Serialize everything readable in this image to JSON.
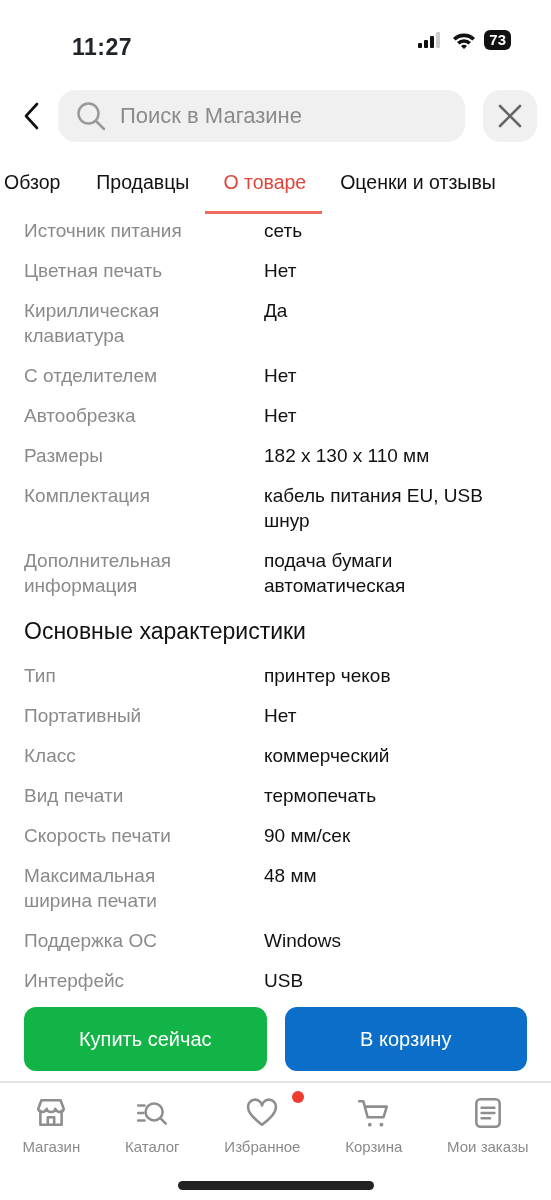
{
  "status_bar": {
    "time": "11:27",
    "battery": "73"
  },
  "search": {
    "placeholder": "Поиск в Магазине"
  },
  "tabs": [
    {
      "label": "Обзор",
      "selected": false
    },
    {
      "label": "Продавцы",
      "selected": false
    },
    {
      "label": "О товаре",
      "selected": true
    },
    {
      "label": "Оценки и отзывы",
      "selected": false
    }
  ],
  "sections": [
    {
      "rows": [
        {
          "name": "Источник питания",
          "value": "сеть"
        },
        {
          "name": "Цветная печать",
          "value": "Нет"
        },
        {
          "name": "Кириллическая клавиатура",
          "value": "Да"
        },
        {
          "name": "С отделителем",
          "value": "Нет"
        },
        {
          "name": "Автообрезка",
          "value": "Нет"
        },
        {
          "name": "Размеры",
          "value": "182 x 130 x 110 мм"
        },
        {
          "name": "Комплектация",
          "value": "кабель питания EU, USB шнур"
        },
        {
          "name": "Дополнительная информация",
          "value": "подача бумаги автоматическая"
        }
      ]
    },
    {
      "title": "Основные характеристики",
      "rows": [
        {
          "name": "Тип",
          "value": "принтер чеков"
        },
        {
          "name": "Портативный",
          "value": "Нет"
        },
        {
          "name": "Класс",
          "value": "коммерческий"
        },
        {
          "name": "Вид печати",
          "value": "термопечать"
        },
        {
          "name": "Скорость печати",
          "value": "90 мм/сек"
        },
        {
          "name": "Максимальная ширина печати",
          "value": "48 мм"
        },
        {
          "name": "Поддержка ОС",
          "value": "Windows"
        },
        {
          "name": "Интерфейс",
          "value": "USB"
        }
      ]
    }
  ],
  "actions": [
    {
      "label": "Купить сейчас",
      "kind": "buy"
    },
    {
      "label": "В корзину",
      "kind": "cart"
    }
  ],
  "nav": [
    {
      "label": "Магазин",
      "kind": "shop",
      "badge": false
    },
    {
      "label": "Каталог",
      "kind": "catalog",
      "badge": false
    },
    {
      "label": "Избранное",
      "kind": "favorites",
      "badge": true
    },
    {
      "label": "Корзина",
      "kind": "cart",
      "badge": false
    },
    {
      "label": "Мои заказы",
      "kind": "orders",
      "badge": false
    }
  ]
}
